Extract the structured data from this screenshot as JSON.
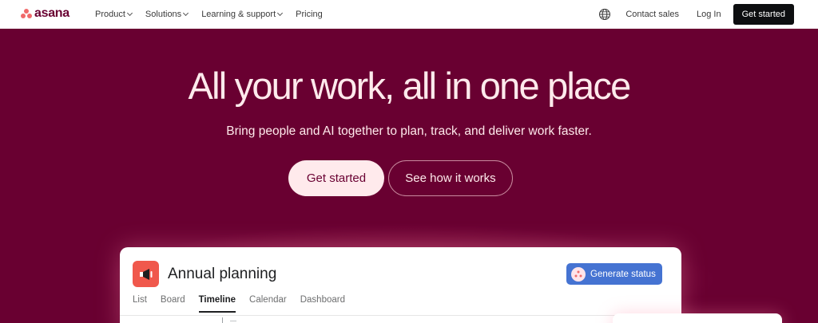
{
  "brand": {
    "name": "asana"
  },
  "nav": {
    "items": [
      {
        "label": "Product"
      },
      {
        "label": "Solutions"
      },
      {
        "label": "Learning & support"
      },
      {
        "label": "Pricing"
      }
    ],
    "contact_label": "Contact sales",
    "login_label": "Log In",
    "cta_label": "Get started"
  },
  "hero": {
    "title": "All your work, all in one place",
    "subtitle": "Bring people and AI together to plan, track, and deliver work faster.",
    "primary_cta": "Get started",
    "secondary_cta": "See how it works"
  },
  "product_card": {
    "project_title": "Annual planning",
    "generate_label": "Generate status",
    "tabs": [
      {
        "label": "List",
        "active": false
      },
      {
        "label": "Board",
        "active": false
      },
      {
        "label": "Timeline",
        "active": true
      },
      {
        "label": "Calendar",
        "active": false
      },
      {
        "label": "Dashboard",
        "active": false
      }
    ]
  },
  "colors": {
    "hero_bg": "#690031",
    "hero_text": "#ffeaec",
    "accent_coral": "#f06a6a",
    "generate_blue": "#4573d2",
    "nav_cta_bg": "#0d0e10"
  },
  "icons": {
    "logo": "asana-dots-icon",
    "globe": "globe-icon",
    "project": "megaphone-icon",
    "generate": "ai-sparkle-icon"
  }
}
